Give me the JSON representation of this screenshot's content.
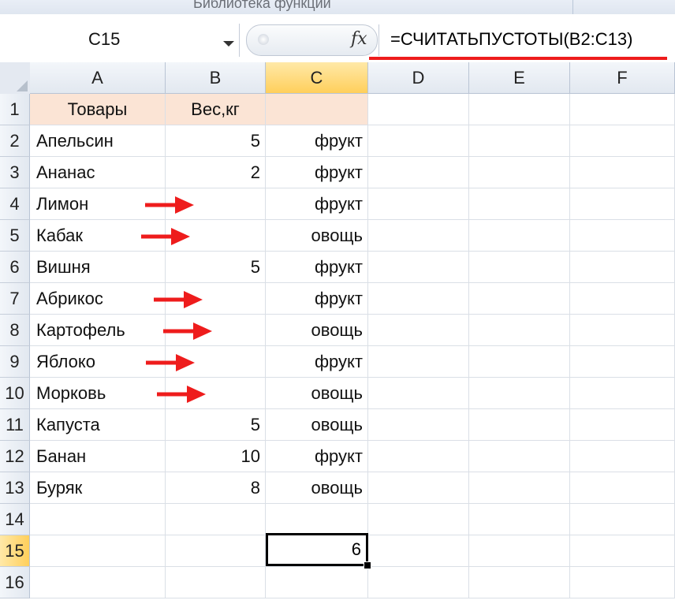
{
  "ribbon": {
    "group_label": "Библиотека функций"
  },
  "formula_bar": {
    "name_box": "C15",
    "fx_label": "fx",
    "formula": "=СЧИТАТЬПУСТОТЫ(B2:C13)"
  },
  "columns": [
    "A",
    "B",
    "C",
    "D",
    "E",
    "F"
  ],
  "active_column": "C",
  "active_row": "15",
  "rows": [
    {
      "n": "1",
      "a": "Товары",
      "b": "Вес,кг",
      "c": ""
    },
    {
      "n": "2",
      "a": "Апельсин",
      "b": "5",
      "c": "фрукт"
    },
    {
      "n": "3",
      "a": "Ананас",
      "b": "2",
      "c": "фрукт"
    },
    {
      "n": "4",
      "a": "Лимон",
      "b": "",
      "c": "фрукт"
    },
    {
      "n": "5",
      "a": "Кабак",
      "b": "",
      "c": "овощь"
    },
    {
      "n": "6",
      "a": "Вишня",
      "b": "5",
      "c": "фрукт"
    },
    {
      "n": "7",
      "a": "Абрикос",
      "b": "",
      "c": "фрукт"
    },
    {
      "n": "8",
      "a": "Картофель",
      "b": "",
      "c": "овощь"
    },
    {
      "n": "9",
      "a": "Яблоко",
      "b": "",
      "c": "фрукт"
    },
    {
      "n": "10",
      "a": "Морковь",
      "b": "",
      "c": "овощь"
    },
    {
      "n": "11",
      "a": "Капуста",
      "b": "5",
      "c": "овощь"
    },
    {
      "n": "12",
      "a": "Банан",
      "b": "10",
      "c": "фрукт"
    },
    {
      "n": "13",
      "a": "Буряк",
      "b": "8",
      "c": "овощь"
    },
    {
      "n": "14",
      "a": "",
      "b": "",
      "c": ""
    },
    {
      "n": "15",
      "a": "",
      "b": "",
      "c": ""
    },
    {
      "n": "16",
      "a": "",
      "b": "",
      "c": ""
    }
  ],
  "result_cell": {
    "ref": "C15",
    "value": "6"
  },
  "arrow_rows": [
    "4",
    "5",
    "7",
    "8",
    "9",
    "10"
  ],
  "colors": {
    "arrow": "#ee1c1c",
    "header_fill": "#fbe4d5",
    "active_header": "#ffcf5b"
  }
}
